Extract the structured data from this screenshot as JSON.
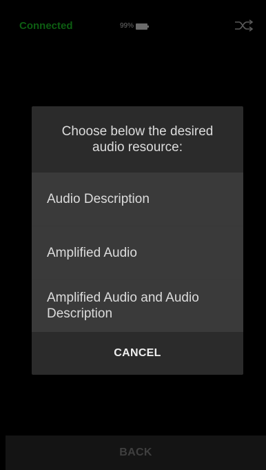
{
  "colors": {
    "screen_bg": "#000000",
    "connected_text": "#0d5e12",
    "status_muted": "#6b6b6b",
    "dialog_header_bg": "#2b2b2b",
    "dialog_options_bg": "#3a3a3a",
    "dialog_footer_bg": "#2b2b2b",
    "dialog_text": "#dcdcdc",
    "bottom_bar_bg": "#141414",
    "bottom_bar_text": "#3f3f3f"
  },
  "status_bar": {
    "connection_status": "Connected",
    "battery_level": "99%",
    "shuffle_icon": "shuffle-icon"
  },
  "dialog": {
    "title": "Choose below the desired audio resource:",
    "options": [
      "Audio Description",
      "Amplified Audio",
      "Amplified Audio and Audio Description"
    ],
    "cancel_label": "CANCEL"
  },
  "bottom_bar": {
    "back_label": "BACK"
  }
}
